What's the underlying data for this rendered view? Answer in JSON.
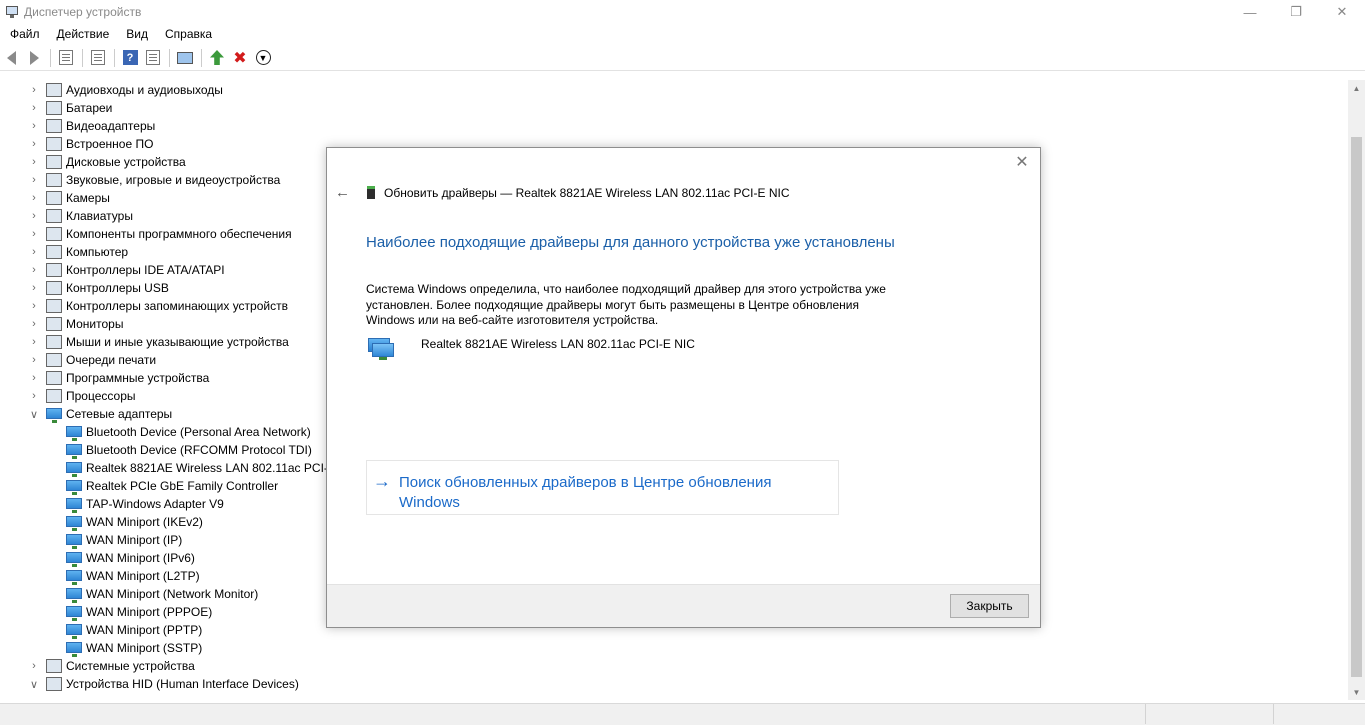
{
  "window": {
    "title": "Диспетчер устройств"
  },
  "menu": [
    "Файл",
    "Действие",
    "Вид",
    "Справка"
  ],
  "toolbar": {
    "icons": [
      "back-icon",
      "forward-icon",
      "properties-icon",
      "list-icon",
      "help-icon",
      "view-icon",
      "monitor-icon",
      "update-driver-icon",
      "uninstall-icon",
      "scan-icon"
    ]
  },
  "tree": {
    "categories": [
      {
        "label": "Аудиовходы и аудиовыходы",
        "expanded": false
      },
      {
        "label": "Батареи",
        "expanded": false
      },
      {
        "label": "Видеоадаптеры",
        "expanded": false
      },
      {
        "label": "Встроенное ПО",
        "expanded": false
      },
      {
        "label": "Дисковые устройства",
        "expanded": false
      },
      {
        "label": "Звуковые, игровые и видеоустройства",
        "expanded": false
      },
      {
        "label": "Камеры",
        "expanded": false
      },
      {
        "label": "Клавиатуры",
        "expanded": false
      },
      {
        "label": "Компоненты программного обеспечения",
        "expanded": false
      },
      {
        "label": "Компьютер",
        "expanded": false
      },
      {
        "label": "Контроллеры IDE ATA/ATAPI",
        "expanded": false
      },
      {
        "label": "Контроллеры USB",
        "expanded": false
      },
      {
        "label": "Контроллеры запоминающих устройств",
        "expanded": false
      },
      {
        "label": "Мониторы",
        "expanded": false
      },
      {
        "label": "Мыши и иные указывающие устройства",
        "expanded": false
      },
      {
        "label": "Очереди печати",
        "expanded": false
      },
      {
        "label": "Программные устройства",
        "expanded": false
      },
      {
        "label": "Процессоры",
        "expanded": false
      },
      {
        "label": "Сетевые адаптеры",
        "expanded": true
      }
    ],
    "network_adapters": [
      "Bluetooth Device (Personal Area Network)",
      "Bluetooth Device (RFCOMM Protocol TDI)",
      "Realtek 8821AE Wireless LAN 802.11ac PCI-E NIC",
      "Realtek PCIe GbE Family Controller",
      "TAP-Windows Adapter V9",
      "WAN Miniport (IKEv2)",
      "WAN Miniport (IP)",
      "WAN Miniport (IPv6)",
      "WAN Miniport (L2TP)",
      "WAN Miniport (Network Monitor)",
      "WAN Miniport (PPPOE)",
      "WAN Miniport (PPTP)",
      "WAN Miniport (SSTP)"
    ],
    "after": [
      {
        "label": "Системные устройства",
        "expanded": false
      },
      {
        "label": "Устройства HID (Human Interface Devices)",
        "expanded": true
      }
    ]
  },
  "dialog": {
    "header": "Обновить драйверы — Realtek 8821AE Wireless LAN 802.11ac PCI-E NIC",
    "heading": "Наиболее подходящие драйверы для данного устройства уже установлены",
    "body": "Система Windows определила, что наиболее подходящий драйвер для этого устройства уже установлен. Более подходящие драйверы могут быть размещены в Центре обновления Windows или на веб-сайте изготовителя устройства.",
    "device_name": "Realtek 8821AE Wireless LAN 802.11ac PCI-E NIC",
    "link": "Поиск обновленных драйверов в Центре обновления Windows",
    "close_button": "Закрыть"
  },
  "colors": {
    "heading_blue": "#1b5fa8",
    "link_blue": "#1b6ac9"
  }
}
